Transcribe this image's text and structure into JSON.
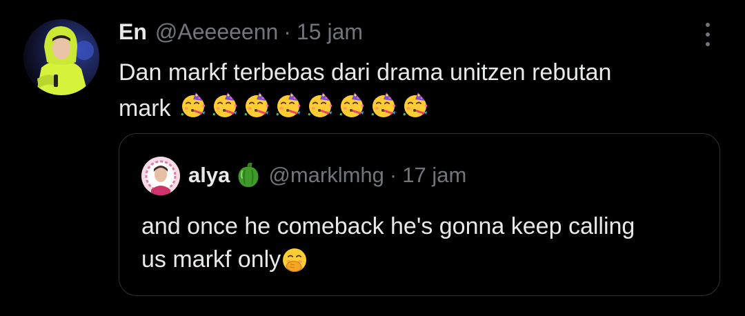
{
  "tweet": {
    "author_name": "En",
    "author_handle": "@Aeeeeenn",
    "separator": "·",
    "time": "15 jam",
    "text_line1": "Dan markf terbebas dari drama unitzen rebutan",
    "text_line2": "mark",
    "emojis": [
      "partying-face",
      "partying-face",
      "partying-face",
      "partying-face",
      "partying-face",
      "partying-face",
      "partying-face",
      "partying-face"
    ]
  },
  "quoted": {
    "author_name": "alya",
    "badge_icon": "bell-pepper",
    "author_handle": "@marklmhg",
    "separator": "·",
    "time": "17 jam",
    "text_line1": "and once he comeback he's gonna keep calling",
    "text_line2": "us markf only",
    "trailing_emoji": "hand-over-mouth-face"
  },
  "colors": {
    "background": "#000000",
    "text_primary": "#e7e9ea",
    "text_secondary": "#71767b",
    "border": "#2f3336"
  }
}
